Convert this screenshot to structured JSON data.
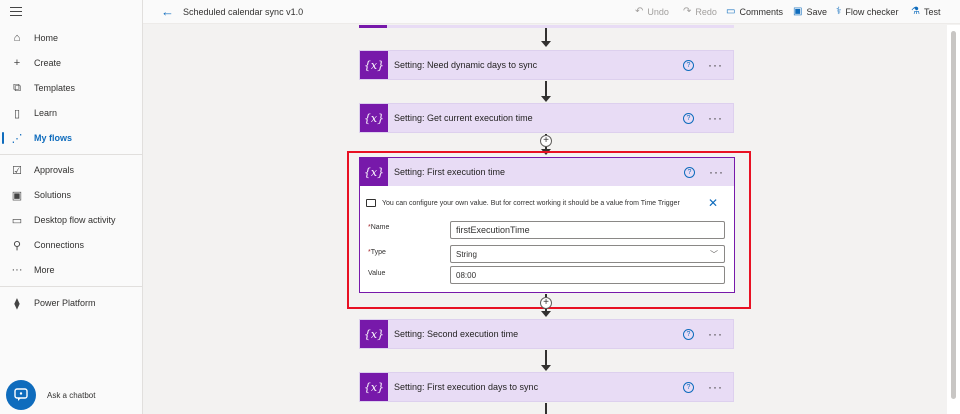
{
  "sidebar": {
    "items": [
      {
        "label": "Home",
        "icon": "home-icon"
      },
      {
        "label": "Create",
        "icon": "plus-icon"
      },
      {
        "label": "Templates",
        "icon": "templates-icon"
      },
      {
        "label": "Learn",
        "icon": "book-icon"
      },
      {
        "label": "My flows",
        "icon": "flows-icon",
        "active": true
      },
      {
        "label": "Approvals",
        "icon": "approvals-icon"
      },
      {
        "label": "Solutions",
        "icon": "solutions-icon"
      },
      {
        "label": "Desktop flow activity",
        "icon": "desktop-flow-icon"
      },
      {
        "label": "Connections",
        "icon": "connections-icon"
      },
      {
        "label": "More",
        "icon": "more-icon"
      },
      {
        "label": "Power Platform",
        "icon": "power-platform-icon"
      }
    ],
    "chatbot_label": "Ask a chatbot"
  },
  "header": {
    "title": "Scheduled calendar sync v1.0",
    "undo": "Undo",
    "redo": "Redo",
    "comments": "Comments",
    "save": "Save",
    "flow_checker": "Flow checker",
    "test": "Test"
  },
  "steps": {
    "need_days": "Setting: Need dynamic days to sync",
    "current_time": "Setting: Get current execution time",
    "first_time": "Setting: First execution time",
    "second_time": "Setting: Second execution time",
    "first_days": "Setting: First execution days to sync"
  },
  "step_icon_text": "{x}",
  "help_text": "?",
  "more_text": "···",
  "card": {
    "info": "You can configure your own value. But for correct working it should be a value from Time Trigger",
    "name_label": "Name",
    "name_value": "firstExecutionTime",
    "type_label": "Type",
    "type_value": "String",
    "value_label": "Value",
    "value_value": "08:00",
    "required_mark": "*"
  },
  "colors": {
    "accent": "#0f6cbd",
    "variable_purple": "#7719aa",
    "step_bg": "#e8dcf5",
    "highlight_red": "#e81123"
  }
}
